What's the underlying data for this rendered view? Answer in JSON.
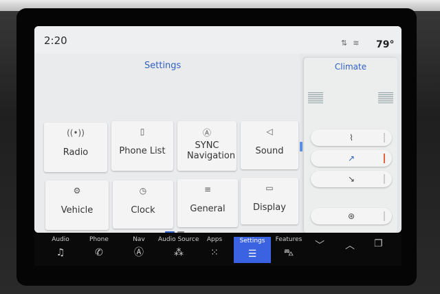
{
  "status": {
    "time": "2:20",
    "icons": [
      "sort-icon",
      "wifi-icon"
    ],
    "temperature": "79°"
  },
  "settings": {
    "title": "Settings",
    "tiles": [
      {
        "label": "Radio",
        "icon": "radio-signal-icon",
        "glyph": "((•))"
      },
      {
        "label": "Phone List",
        "icon": "phone-icon",
        "glyph": "▯"
      },
      {
        "label": "SYNC Navigation",
        "icon": "navigation-icon",
        "glyph": "Ⓐ"
      },
      {
        "label": "Sound",
        "icon": "speaker-icon",
        "glyph": "◁"
      },
      {
        "label": "Vehicle",
        "icon": "vehicle-icon",
        "glyph": "⚙"
      },
      {
        "label": "Clock",
        "icon": "clock-icon",
        "glyph": "◷"
      },
      {
        "label": "General",
        "icon": "sliders-icon",
        "glyph": "≡"
      },
      {
        "label": "Display",
        "icon": "display-icon",
        "glyph": "▭"
      }
    ]
  },
  "climate": {
    "title": "Climate",
    "buttons": [
      {
        "icon": "defrost-icon",
        "glyph": "⌇",
        "active": false
      },
      {
        "icon": "airflow-face-feet-icon",
        "glyph": "↗",
        "active": true
      },
      {
        "icon": "airflow-feet-icon",
        "glyph": "↘",
        "active": false
      },
      {
        "icon": "heated-steering-icon",
        "glyph": "⊛",
        "active": false
      }
    ]
  },
  "nav": {
    "items": [
      {
        "label": "Audio",
        "icon": "music-note-icon",
        "glyph": "♫",
        "active": false
      },
      {
        "label": "Phone",
        "icon": "phone-handset-icon",
        "glyph": "✆",
        "active": false
      },
      {
        "label": "Nav",
        "icon": "navigation-icon",
        "glyph": "Ⓐ",
        "active": false
      },
      {
        "label": "Audio Sources",
        "icon": "audio-sources-icon",
        "glyph": "⁂",
        "active": false
      },
      {
        "label": "Apps",
        "icon": "apps-grid-icon",
        "glyph": "⁙",
        "active": false
      },
      {
        "label": "Settings",
        "icon": "settings-sliders-icon",
        "glyph": "☰",
        "active": true
      },
      {
        "label": "Features",
        "icon": "car-icon",
        "glyph": "⛍",
        "active": false
      }
    ],
    "extras": [
      {
        "icon": "chevron-down-icon",
        "glyph": "﹀"
      },
      {
        "icon": "chevron-up-icon",
        "glyph": "︿"
      },
      {
        "icon": "windows-icon",
        "glyph": "❐"
      }
    ]
  }
}
